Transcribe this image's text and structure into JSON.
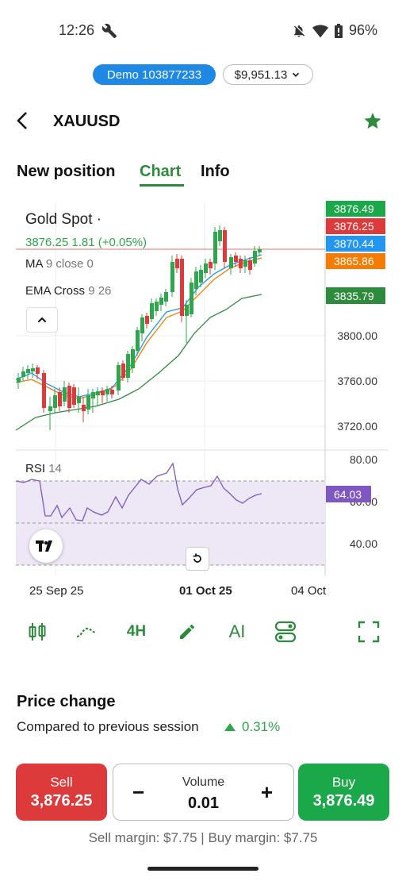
{
  "status": {
    "time": "12:26",
    "battery": "96%"
  },
  "account": {
    "label": "Demo 103877233",
    "balance": "$9,951.13"
  },
  "header": {
    "symbol": "XAUUSD"
  },
  "tabs": [
    "New position",
    "Chart",
    "Info"
  ],
  "chart": {
    "title": "Gold Spot ·",
    "price_line": "3876.25  1.81 (+0.05%)",
    "ma_label": "MA",
    "ma_params": "9 close 0",
    "ema_label": "EMA Cross",
    "ema_params": "9 26",
    "y_labels": [
      "3800.00",
      "3760.00",
      "3720.00"
    ],
    "price_tags": [
      {
        "value": "3876.49",
        "color": "#1ba84a"
      },
      {
        "value": "3876.25",
        "color": "#dd3b3b"
      },
      {
        "value": "3870.44",
        "color": "#2196f3"
      },
      {
        "value": "3865.86",
        "color": "#f57c00"
      },
      {
        "value": "3835.79",
        "color": "#2e8b3e"
      }
    ],
    "rsi_label": "RSI",
    "rsi_param": "14",
    "rsi_value": "64.03",
    "rsi_y_labels": [
      "80.00",
      "60.00",
      "40.00"
    ],
    "x_labels": [
      "25 Sep 25",
      "01 Oct 25",
      "04 Oct"
    ]
  },
  "toolbar": {
    "timeframe": "4H",
    "ai": "AI"
  },
  "price_change": {
    "title": "Price change",
    "subtitle": "Compared to previous session",
    "value": "0.31%"
  },
  "trade": {
    "sell_label": "Sell",
    "sell_price": "3,876.25",
    "volume_label": "Volume",
    "volume_value": "0.01",
    "minus": "−",
    "plus": "+",
    "buy_label": "Buy",
    "buy_price": "3,876.49",
    "margins": "Sell margin: $7.75 | Buy margin: $7.75"
  },
  "colors": {
    "accent": "#2e8b3e",
    "sell": "#dd3b3b",
    "buy": "#1ba84a",
    "demo": "#1e88e5",
    "rsi": "#7e57c2"
  }
}
